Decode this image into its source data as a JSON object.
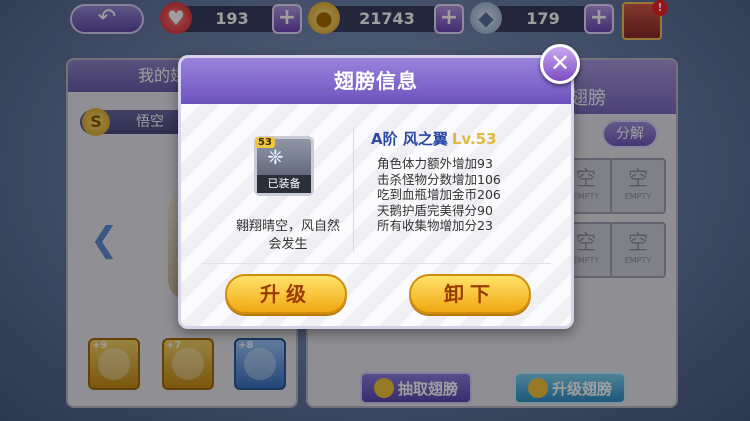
{
  "topbar": {
    "back_icon": "↶",
    "hearts": {
      "icon": "heart-icon",
      "value": "193"
    },
    "gold": {
      "icon": "coin-icon",
      "value": "21743"
    },
    "gems": {
      "icon": "gem-icon",
      "value": "179"
    },
    "plus": "+",
    "book_badge": "!"
  },
  "left_panel": {
    "title": "我的翅膀",
    "hero_name": "悟空",
    "coin_letter": "S",
    "arrow": "❮",
    "items": [
      {
        "level": "+9",
        "name": "golden-shield"
      },
      {
        "level": "+7",
        "name": "trophy-cup"
      },
      {
        "level": "+8",
        "name": "blue-club"
      }
    ]
  },
  "right_panel": {
    "title": "翅膀",
    "split_label": "分解",
    "slots": [
      {
        "kanji": "空",
        "sub": "EMPTY"
      },
      {
        "kanji": "空",
        "sub": "EMPTY"
      },
      {
        "kanji": "空",
        "sub": "EMPTY"
      },
      {
        "kanji": "空",
        "sub": "EMPTY"
      }
    ],
    "draw_button": "抽取翅膀",
    "upgrade_button": "升级翅膀"
  },
  "modal": {
    "title": "翅膀信息",
    "close_icon": "✕",
    "wing": {
      "level_badge": "53",
      "equipped_label": "已装备",
      "tier_name": "A阶 风之翼",
      "level_text": "Lv.53",
      "flavor_text": "翱翔晴空，风自然会发生",
      "stats": [
        "角色体力额外增加93",
        "击杀怪物分数增加106",
        "吃到血瓶增加金币206",
        "天鹅护盾完美得分90",
        "所有收集物增加分23"
      ]
    },
    "upgrade_label": "升级",
    "unequip_label": "卸下"
  }
}
